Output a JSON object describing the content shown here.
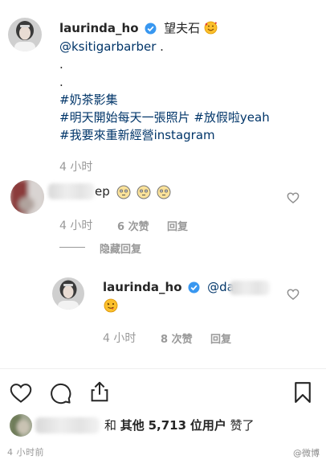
{
  "caption": {
    "username": "laurinda_ho",
    "title_text": "望夫石",
    "mention": "@ksitigarbarber",
    "mention_suffix": " .",
    "dot1": ".",
    "dot2": ".",
    "hashtag1": "#奶茶影集",
    "hashtag2": "#明天開始每天一張照片",
    "hashtag3": "#放假啦yeah",
    "hashtag4": "#我要來重新經營instagram",
    "time": "4 小时"
  },
  "comment1": {
    "text_fragment": "ep",
    "time": "4 小时",
    "likes": "6 次赞",
    "reply_label": "回复",
    "hide_replies": "隐藏回复"
  },
  "reply1": {
    "username": "laurinda_ho",
    "mention_prefix": "@da",
    "time": "4 小时",
    "likes": "8 次赞",
    "reply_label": "回复"
  },
  "likes_summary": {
    "and": "和",
    "others": "其他",
    "count": "5,713",
    "unit": "位用户",
    "suffix": "赞了"
  },
  "post_time": "4 小时前",
  "watermark": "@微博",
  "colors": {
    "text": "#262626",
    "meta": "#999999",
    "link": "#003569",
    "verified": "#3897f0"
  },
  "icons": [
    "verified-badge-icon",
    "smiling-face-hearts-icon",
    "heart-icon",
    "comment-icon",
    "share-icon",
    "bookmark-icon",
    "flushed-face-icon",
    "tongue-face-icon"
  ]
}
